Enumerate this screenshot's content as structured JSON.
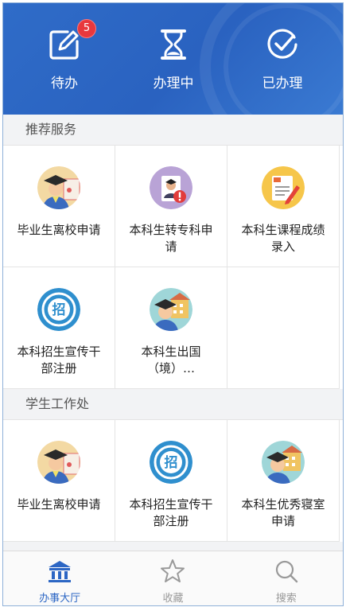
{
  "header": {
    "todo": {
      "label": "待办",
      "badge": "5",
      "icon": "edit-icon"
    },
    "processing": {
      "label": "办理中",
      "icon": "hourglass-icon"
    },
    "done": {
      "label": "已办理",
      "icon": "check-circle-icon"
    }
  },
  "sections": [
    {
      "title": "推荐服务",
      "items": [
        {
          "label": "毕业生离校申请",
          "icon": "graduate-avatar-icon"
        },
        {
          "label": "本科生转专科申请",
          "icon": "transfer-notice-icon"
        },
        {
          "label": "本科生课程成绩录入",
          "icon": "grade-entry-icon"
        },
        {
          "label": "本科招生宣传干部注册",
          "icon": "recruit-icon"
        },
        {
          "label": "本科生出国（境）…",
          "icon": "abroad-school-icon"
        }
      ]
    },
    {
      "title": "学生工作处",
      "items": [
        {
          "label": "毕业生离校申请",
          "icon": "graduate-avatar-icon"
        },
        {
          "label": "本科招生宣传干部注册",
          "icon": "recruit-icon"
        },
        {
          "label": "本科生优秀寝室申请",
          "icon": "abroad-school-icon"
        }
      ]
    }
  ],
  "tabbar": {
    "hall": {
      "label": "办事大厅",
      "icon": "bank-icon",
      "active": true
    },
    "favorites": {
      "label": "收藏",
      "icon": "star-icon"
    },
    "search": {
      "label": "搜索",
      "icon": "search-icon"
    }
  },
  "colors": {
    "accent": "#2c66c4",
    "badge": "#e8383d",
    "inactive": "#999999"
  }
}
